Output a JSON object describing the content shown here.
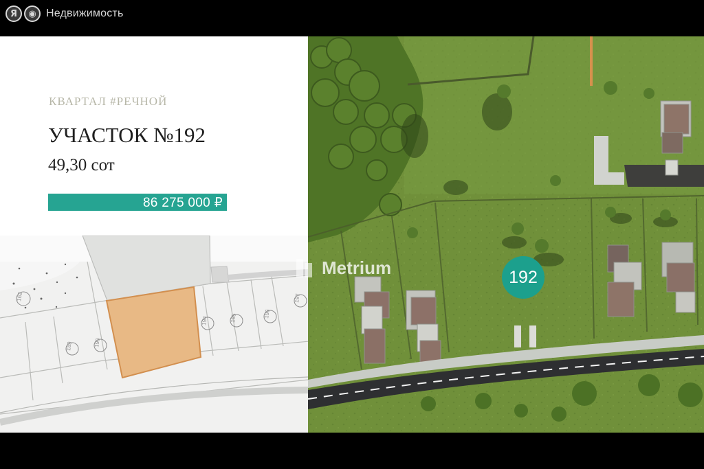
{
  "app": {
    "brand_name": "Недвижимость",
    "logo_letter": "Я"
  },
  "listing": {
    "district": "КВАРТАЛ #РЕЧНОЙ",
    "plot_title": "УЧАСТОК №192",
    "area": "49,30 сот",
    "price": "86 275 000 ₽"
  },
  "map": {
    "selected_plot_badge": "192",
    "plot_numbers": [
      "162",
      "193",
      "194",
      "195",
      "196",
      "197",
      "189",
      "190"
    ],
    "watermark": "Metrium"
  },
  "colors": {
    "accent": "#26a492",
    "selected_plot": "#e8b985",
    "grass": "#6e8f38"
  }
}
